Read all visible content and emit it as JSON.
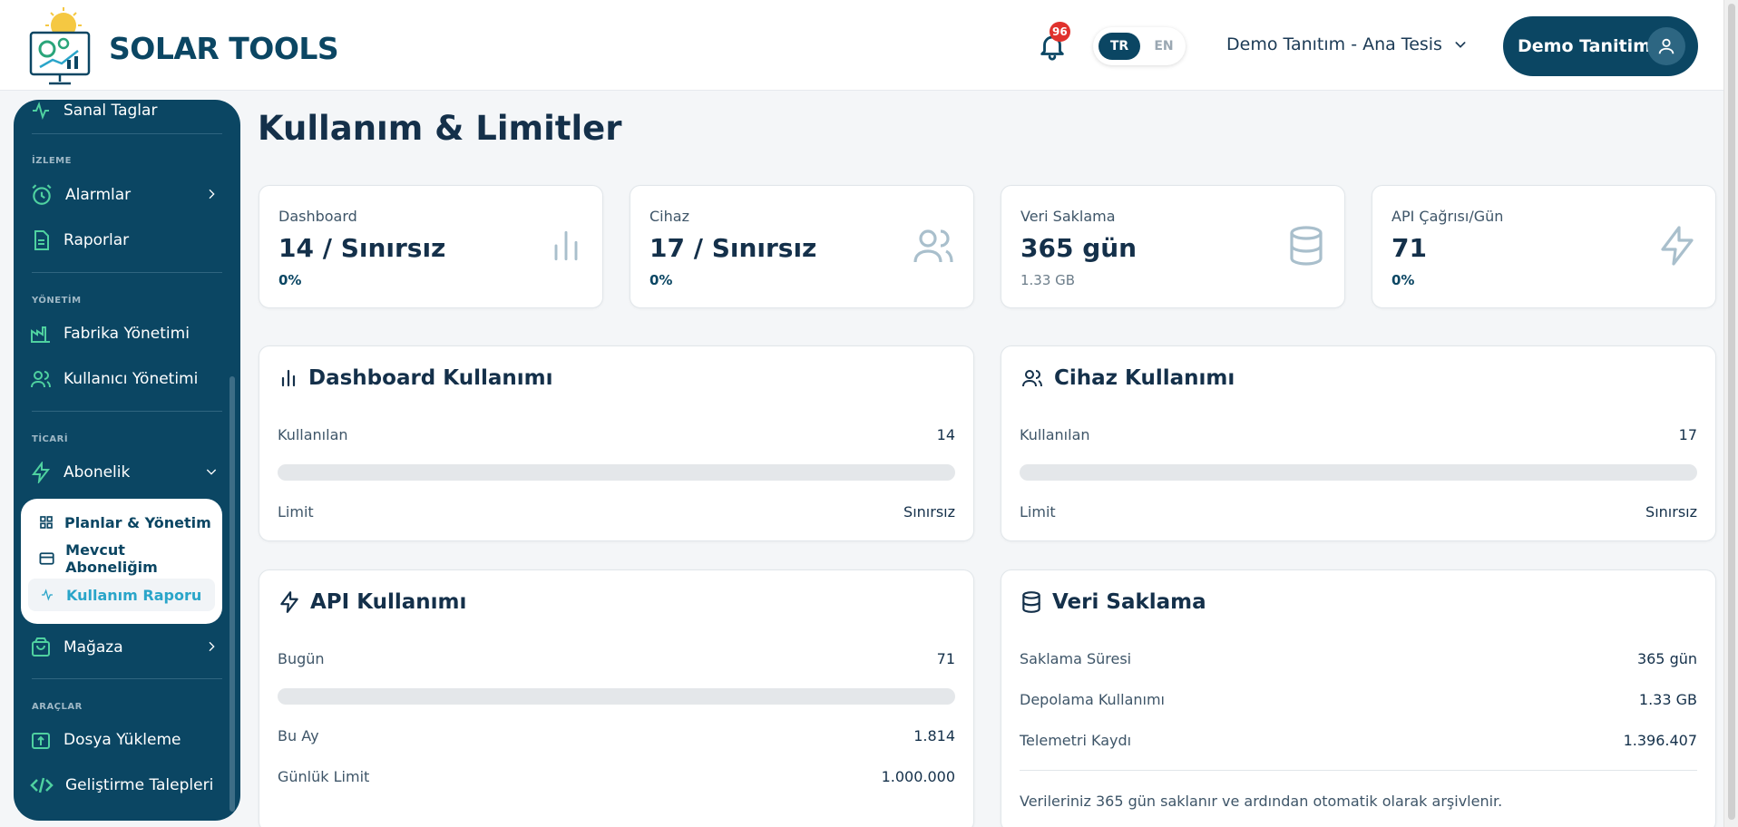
{
  "brand": {
    "name": "SOLAR TOOLS"
  },
  "header": {
    "notification_count": "96",
    "lang_tr": "TR",
    "lang_en": "EN",
    "facility": "Demo Tanıtım - Ana Tesis",
    "user_name": "Demo Tanitim"
  },
  "sidebar": {
    "top_partial": "Sanal Taglar",
    "sections": {
      "monitoring": "İZLEME",
      "management": "YÖNETİM",
      "commercial": "TİCARİ",
      "tools": "ARAÇLAR"
    },
    "items": {
      "alarms": "Alarmlar",
      "reports": "Raporlar",
      "factory": "Fabrika Yönetimi",
      "users": "Kullanıcı Yönetimi",
      "subscription": "Abonelik",
      "store": "Mağaza",
      "upload": "Dosya Yükleme",
      "dev_requests": "Geliştirme Talepleri"
    },
    "submenu": {
      "plans": "Planlar & Yönetim",
      "current": "Mevcut Aboneliğim",
      "usage": "Kullanım Raporu"
    }
  },
  "page": {
    "title": "Kullanım & Limitler"
  },
  "stats": {
    "dashboard": {
      "label": "Dashboard",
      "value": "14 / Sınırsız",
      "sub": "0%"
    },
    "device": {
      "label": "Cihaz",
      "value": "17 / Sınırsız",
      "sub": "0%"
    },
    "retention": {
      "label": "Veri Saklama",
      "value": "365 gün",
      "sub": "1.33 GB"
    },
    "api": {
      "label": "API Çağrısı/Gün",
      "value": "71",
      "sub": "0%"
    }
  },
  "dashboard_usage": {
    "title": "Dashboard Kullanımı",
    "used_label": "Kullanılan",
    "used_value": "14",
    "progress": 0,
    "limit_label": "Limit",
    "limit_value": "Sınırsız"
  },
  "device_usage": {
    "title": "Cihaz Kullanımı",
    "used_label": "Kullanılan",
    "used_value": "17",
    "progress": 0,
    "limit_label": "Limit",
    "limit_value": "Sınırsız"
  },
  "api_usage": {
    "title": "API Kullanımı",
    "today_label": "Bugün",
    "today_value": "71",
    "progress": 0,
    "month_label": "Bu Ay",
    "month_value": "1.814",
    "daily_limit_label": "Günlük Limit",
    "daily_limit_value": "1.000.000"
  },
  "data_retention": {
    "title": "Veri Saklama",
    "period_label": "Saklama Süresi",
    "period_value": "365 gün",
    "storage_label": "Depolama Kullanımı",
    "storage_value": "1.33 GB",
    "telemetry_label": "Telemetri Kaydı",
    "telemetry_value": "1.396.407",
    "note": "Verileriniz 365 gün saklanır ve ardından otomatik olarak arşivlenir."
  },
  "colors": {
    "primary": "#0b4663",
    "accent": "#2aa5c9",
    "badge": "#e0322d"
  }
}
